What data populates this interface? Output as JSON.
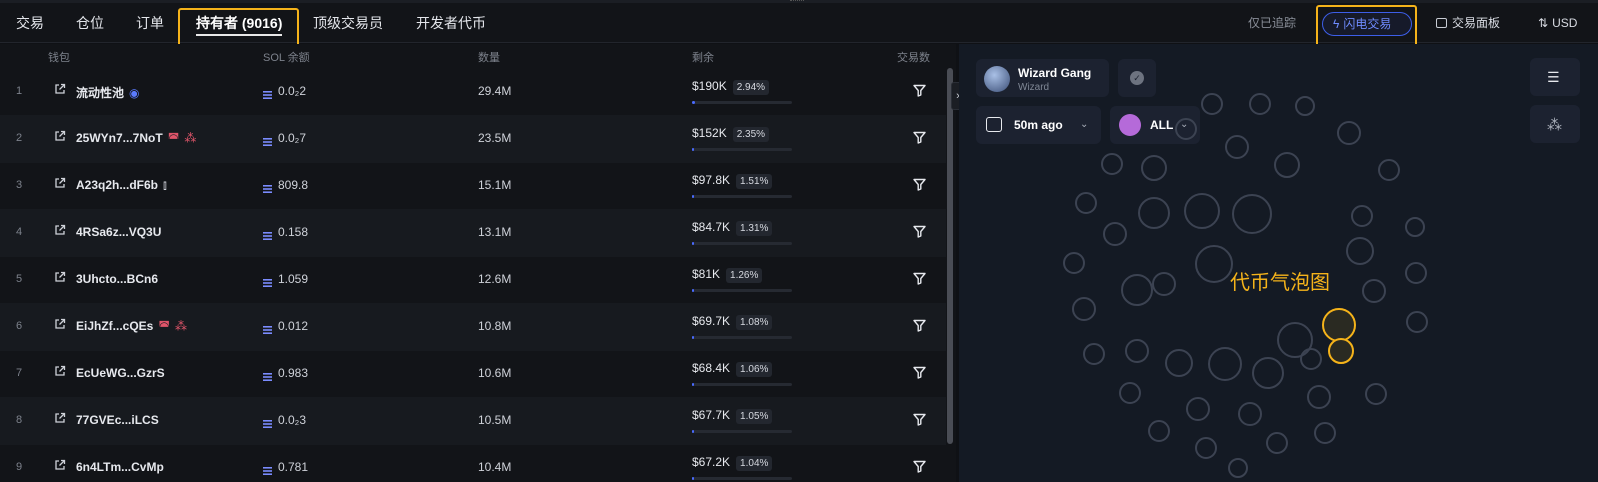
{
  "tabs": [
    {
      "label": "交易"
    },
    {
      "label": "仓位"
    },
    {
      "label": "订单"
    },
    {
      "label": "持有者 (9016)"
    },
    {
      "label": "顶级交易员"
    },
    {
      "label": "开发者代币"
    }
  ],
  "toolbar": {
    "track_only": "仅已追踪",
    "flash_trade": "闪电交易",
    "trade_panel": "交易面板",
    "currency": "USD"
  },
  "table": {
    "headers": {
      "wallet": "钱包",
      "sol": "SOL 余额",
      "qty": "数量",
      "remain": "剩余",
      "trades": "交易数"
    },
    "rows": [
      {
        "rank": "1",
        "wallet": "流动性池",
        "sol": "0.0₂2",
        "qty": "29.4M",
        "remain": "$190K",
        "pct": "2.94%",
        "fill": 0.0294,
        "tags": [
          "pool"
        ]
      },
      {
        "rank": "2",
        "wallet": "25WYn7...7NoT",
        "sol": "0.0₂7",
        "qty": "23.5M",
        "remain": "$152K",
        "pct": "2.35%",
        "fill": 0.0235,
        "tags": [
          "ghost",
          "bundle"
        ]
      },
      {
        "rank": "3",
        "wallet": "A23q2h...dF6b",
        "sol": "809.8",
        "qty": "15.1M",
        "remain": "$97.8K",
        "pct": "1.51%",
        "fill": 0.0151,
        "tags": [
          "candles"
        ]
      },
      {
        "rank": "4",
        "wallet": "4RSa6z...VQ3U",
        "sol": "0.158",
        "qty": "13.1M",
        "remain": "$84.7K",
        "pct": "1.31%",
        "fill": 0.0131,
        "tags": []
      },
      {
        "rank": "5",
        "wallet": "3Uhcto...BCn6",
        "sol": "1.059",
        "qty": "12.6M",
        "remain": "$81K",
        "pct": "1.26%",
        "fill": 0.0126,
        "tags": []
      },
      {
        "rank": "6",
        "wallet": "EiJhZf...cQEs",
        "sol": "0.012",
        "qty": "10.8M",
        "remain": "$69.7K",
        "pct": "1.08%",
        "fill": 0.0108,
        "tags": [
          "ghost",
          "bundle"
        ]
      },
      {
        "rank": "7",
        "wallet": "EcUeWG...GzrS",
        "sol": "0.983",
        "qty": "10.6M",
        "remain": "$68.4K",
        "pct": "1.06%",
        "fill": 0.0106,
        "tags": []
      },
      {
        "rank": "8",
        "wallet": "77GVEc...iLCS",
        "sol": "0.0₂3",
        "qty": "10.5M",
        "remain": "$67.7K",
        "pct": "1.05%",
        "fill": 0.0105,
        "tags": []
      },
      {
        "rank": "9",
        "wallet": "6n4LTm...CvMp",
        "sol": "0.781",
        "qty": "10.4M",
        "remain": "$67.2K",
        "pct": "1.04%",
        "fill": 0.0104,
        "tags": []
      }
    ]
  },
  "bubble_panel": {
    "profile_name": "Wizard Gang",
    "profile_sub": "Wizard",
    "time_filter": "50m ago",
    "holder_filter": "ALL",
    "title": "代币气泡图"
  },
  "colors": {
    "highlight": "#f5b31a",
    "accent": "#4a6bff",
    "flash": "#6f8cff",
    "tag_red": "#e0556a"
  },
  "icons": {
    "external_link": "external-link-icon",
    "sol": "solana-icon",
    "filter": "filter-icon",
    "ghost": "ghost-icon",
    "bundle": "bundle-icon",
    "candles": "candlestick-icon",
    "list": "list-icon",
    "settings": "bubble-settings-icon"
  }
}
